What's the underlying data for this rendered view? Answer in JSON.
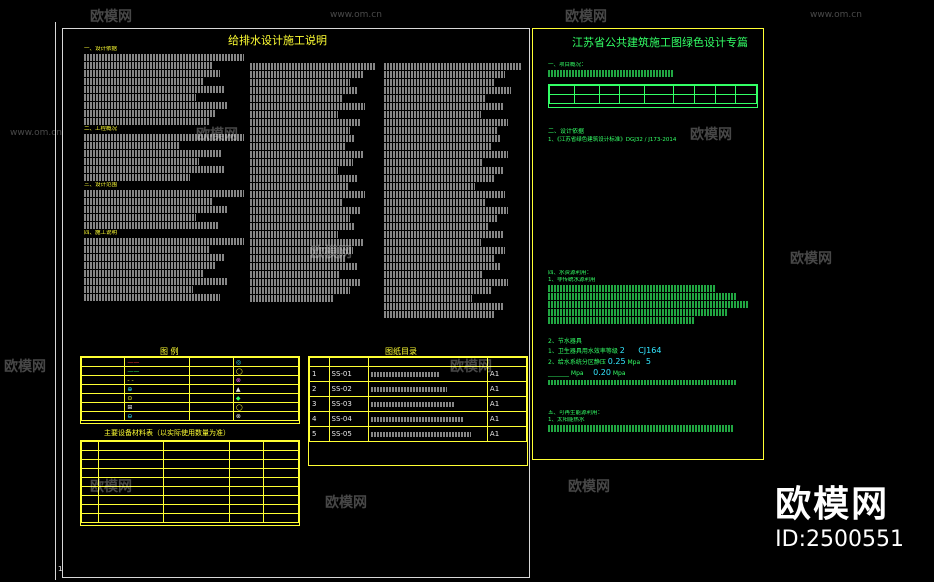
{
  "left_sheet": {
    "title": "给排水设计施工说明",
    "legend_title": "图 例",
    "drawing_index_title": "图纸目录",
    "equipment_title": "主要设备材料表（以实际使用数量为准）",
    "drawing_index": [
      {
        "no": "1",
        "code": "SS-01",
        "size": "A1"
      },
      {
        "no": "2",
        "code": "SS-02",
        "size": "A1"
      },
      {
        "no": "3",
        "code": "SS-03",
        "size": "A1"
      },
      {
        "no": "4",
        "code": "SS-04",
        "size": "A1"
      },
      {
        "no": "5",
        "code": "SS-05",
        "size": "A1"
      }
    ],
    "page_no": "1"
  },
  "right_sheet": {
    "title": "江苏省公共建筑施工图绿色设计专篇",
    "standards": [
      "1、《江苏省绿色建筑设计标准》DGJ32 / J173-2014",
      "2、《绿色建筑评价标准》GB / T 50378-2014",
      "3、《民用建筑节水设计标准》GB / T 229-2010",
      "4、江苏省《公共建筑节能设计标准》DGJ32 / J96-2010",
      "5、《建筑与小区雨水利用工程技术规范》GB 50400-2006",
      "6、《民用建筑节水设计标准》GB 50555-2010",
      "7、江苏省《民用建筑太阳能热水系统应用技术规程》DGJ32 / TJ 113-2011",
      "8、《建筑给水排水及采暖工程施工质量验收规范》GB50364-2005",
      "9、江苏省《建筑生活热水系统技术规程》DGJ32 / J08-2008",
      "10、江苏省《太阳能热水系统与建筑一体化技术规程》DGJ32 / TJ 111-2010",
      "11、《江苏省绿色建筑设计标准》(2014年版)",
      "12、国家、省、市现行的规范、标准及有关规定"
    ],
    "water_meter_label": "2",
    "pipe_code": "CJ164",
    "pressure_1": "0.25",
    "pressure_2": "5",
    "pressure_3": "0.20",
    "section_number": "1"
  },
  "watermark": {
    "brand": "欧模网",
    "site": "www.om.cn",
    "id_text": "ID:2500551"
  }
}
